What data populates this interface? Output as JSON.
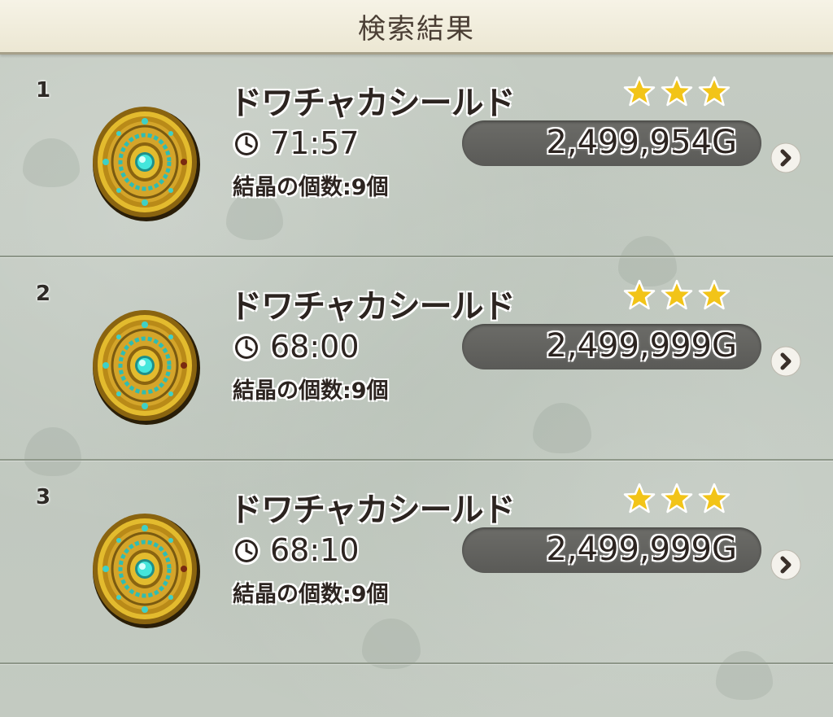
{
  "header": {
    "title": "検索結果"
  },
  "results": [
    {
      "index": "1",
      "name": "ドワチャカシールド",
      "time_left": "71:57",
      "crystal_count": "結晶の個数:9個",
      "stars": 3,
      "price": "2,499,954G",
      "icon": "shield-icon"
    },
    {
      "index": "2",
      "name": "ドワチャカシールド",
      "time_left": "68:00",
      "crystal_count": "結晶の個数:9個",
      "stars": 3,
      "price": "2,499,999G",
      "icon": "shield-icon"
    },
    {
      "index": "3",
      "name": "ドワチャカシールド",
      "time_left": "68:10",
      "crystal_count": "結晶の個数:9個",
      "stars": 3,
      "price": "2,499,999G",
      "icon": "shield-icon"
    }
  ],
  "icons": {
    "time": "clock-icon",
    "rating": "star-icon",
    "detail": "chevron-right-icon"
  },
  "colors": {
    "star": "#f2c418",
    "price_pill": "#5f5f5c",
    "shield_gold": "#c99a1c",
    "shield_gem": "#36d8d0"
  }
}
